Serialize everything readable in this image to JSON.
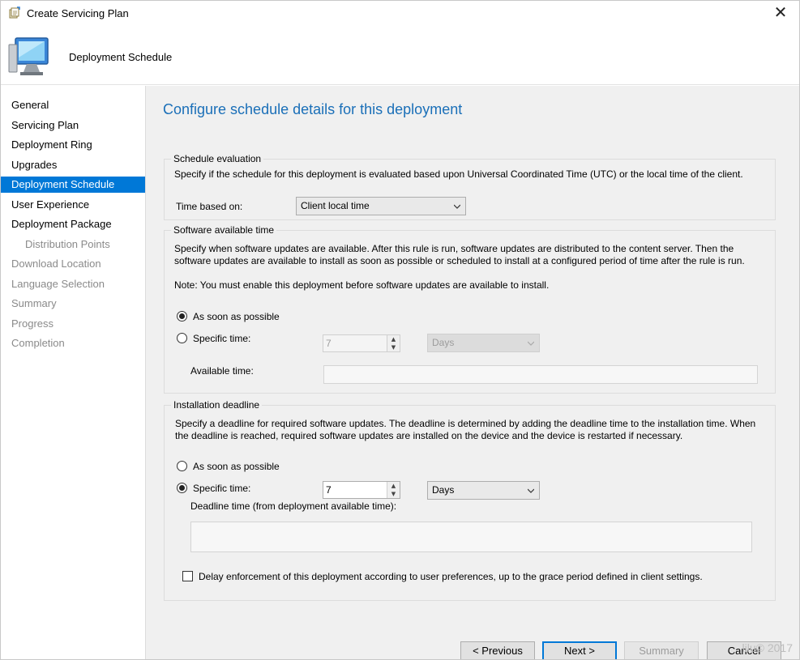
{
  "window": {
    "title": "Create Servicing Plan",
    "close_glyph": "✕"
  },
  "header": {
    "title": "Deployment Schedule",
    "icon": "computer-monitor-icon"
  },
  "sidebar": {
    "items": [
      {
        "label": "General"
      },
      {
        "label": "Servicing Plan"
      },
      {
        "label": "Deployment Ring"
      },
      {
        "label": "Upgrades"
      },
      {
        "label": "Deployment Schedule"
      },
      {
        "label": "User Experience"
      },
      {
        "label": "Deployment Package"
      },
      {
        "label": "Distribution Points"
      },
      {
        "label": "Download Location"
      },
      {
        "label": "Language Selection"
      },
      {
        "label": "Summary"
      },
      {
        "label": "Progress"
      },
      {
        "label": "Completion"
      }
    ]
  },
  "main": {
    "heading": "Configure schedule details for this deployment",
    "schedule_evaluation": {
      "legend": "Schedule evaluation",
      "description": "Specify if the schedule for this deployment is evaluated based upon Universal Coordinated Time (UTC) or the local time of the client.",
      "time_based_label": "Time based on:",
      "time_based_value": "Client local time"
    },
    "software_available": {
      "legend": "Software available time",
      "description_line1": "Specify when software updates are available. After this rule is run, software updates are distributed to the content server. Then the",
      "description_line2": "software updates are available to install as soon as possible or scheduled to install at a configured period of time after the rule is run.",
      "note": "Note: You must enable this deployment before software updates are available to install.",
      "asap_label": "As soon as possible",
      "specific_label": "Specific time:",
      "spin_value": "7",
      "unit_value": "Days",
      "available_time_label": "Available time:"
    },
    "installation_deadline": {
      "legend": "Installation deadline",
      "description_line1": "Specify a deadline for required software updates. The deadline is determined by adding the deadline time to the installation time. When",
      "description_line2": "the deadline is reached, required software updates are installed on the device and the device is restarted if necessary.",
      "asap_label": "As soon as possible",
      "specific_label": "Specific time:",
      "spin_value": "7",
      "unit_value": "Days",
      "deadline_label": "Deadline time (from deployment available time):",
      "delay_label": "Delay enforcement of this deployment according to user preferences, up to the grace period defined in client settings."
    }
  },
  "footer": {
    "previous": "< Previous",
    "next": "Next >",
    "summary": "Summary",
    "cancel": "Cancel"
  },
  "watermark": "lilu© 2017"
}
